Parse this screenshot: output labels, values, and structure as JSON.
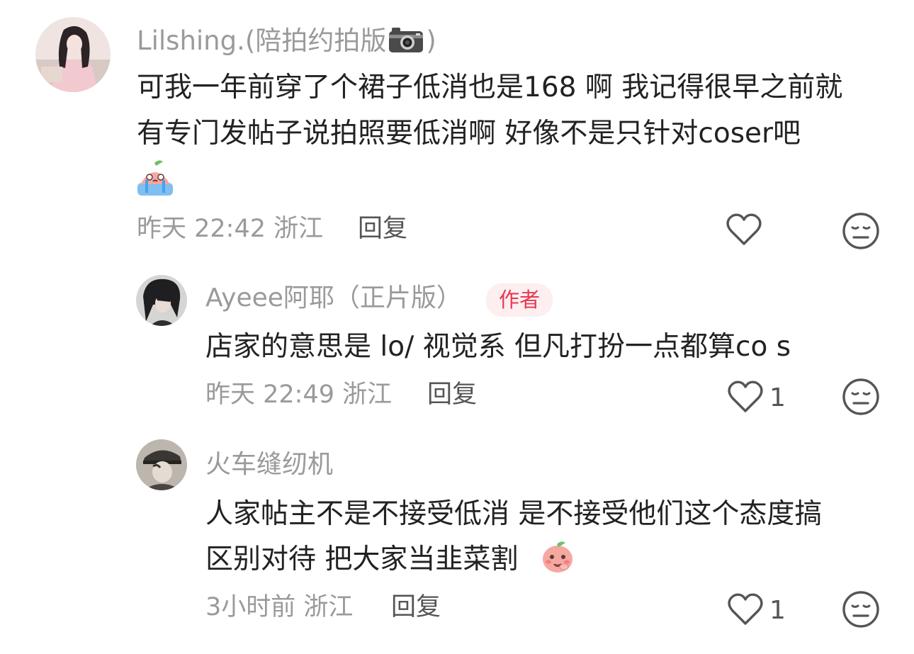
{
  "comments": [
    {
      "username": "Lilshing.(陪拍约拍版",
      "username_suffix": ")",
      "username_icon": "camera-icon",
      "avatar_icon": "avatar-girl-pink",
      "lines": [
        "可我一年前穿了个裙子低消也是168 啊 我记得很早之前就",
        "有专门发帖子说拍照要低消啊 好像不是只针对coser吧"
      ],
      "emoji": "crying-peach-emoji",
      "meta": "昨天 22:42 浙江",
      "reply_label": "回复",
      "like_count": "",
      "like_icon": "heart-outline-icon",
      "dislike_icon": "meh-face-icon"
    },
    {
      "username": "Ayeee阿耶（正片版）",
      "badge": "作者",
      "avatar_icon": "avatar-dark-hair",
      "lines": [
        "店家的意思是 lo/ 视觉系 但凡打扮一点都算co s"
      ],
      "meta": "昨天 22:49 浙江",
      "reply_label": "回复",
      "like_count": "1",
      "like_icon": "heart-outline-icon",
      "dislike_icon": "meh-face-icon"
    },
    {
      "username": "火车缝纫机",
      "avatar_icon": "avatar-cap-man",
      "lines": [
        "人家帖主不是不接受低消 是不接受他们这个态度搞",
        "区别对待 把大家当韭菜割"
      ],
      "emoji": "shy-peach-emoji",
      "meta": "3小时前 浙江",
      "reply_label": "回复",
      "like_count": "1",
      "like_icon": "heart-outline-icon",
      "dislike_icon": "meh-face-icon"
    }
  ],
  "colors": {
    "text": "#222222",
    "muted": "#9a9a9a",
    "action": "#555555",
    "badge_bg": "#fdeef0",
    "badge_text": "#e8384f"
  }
}
